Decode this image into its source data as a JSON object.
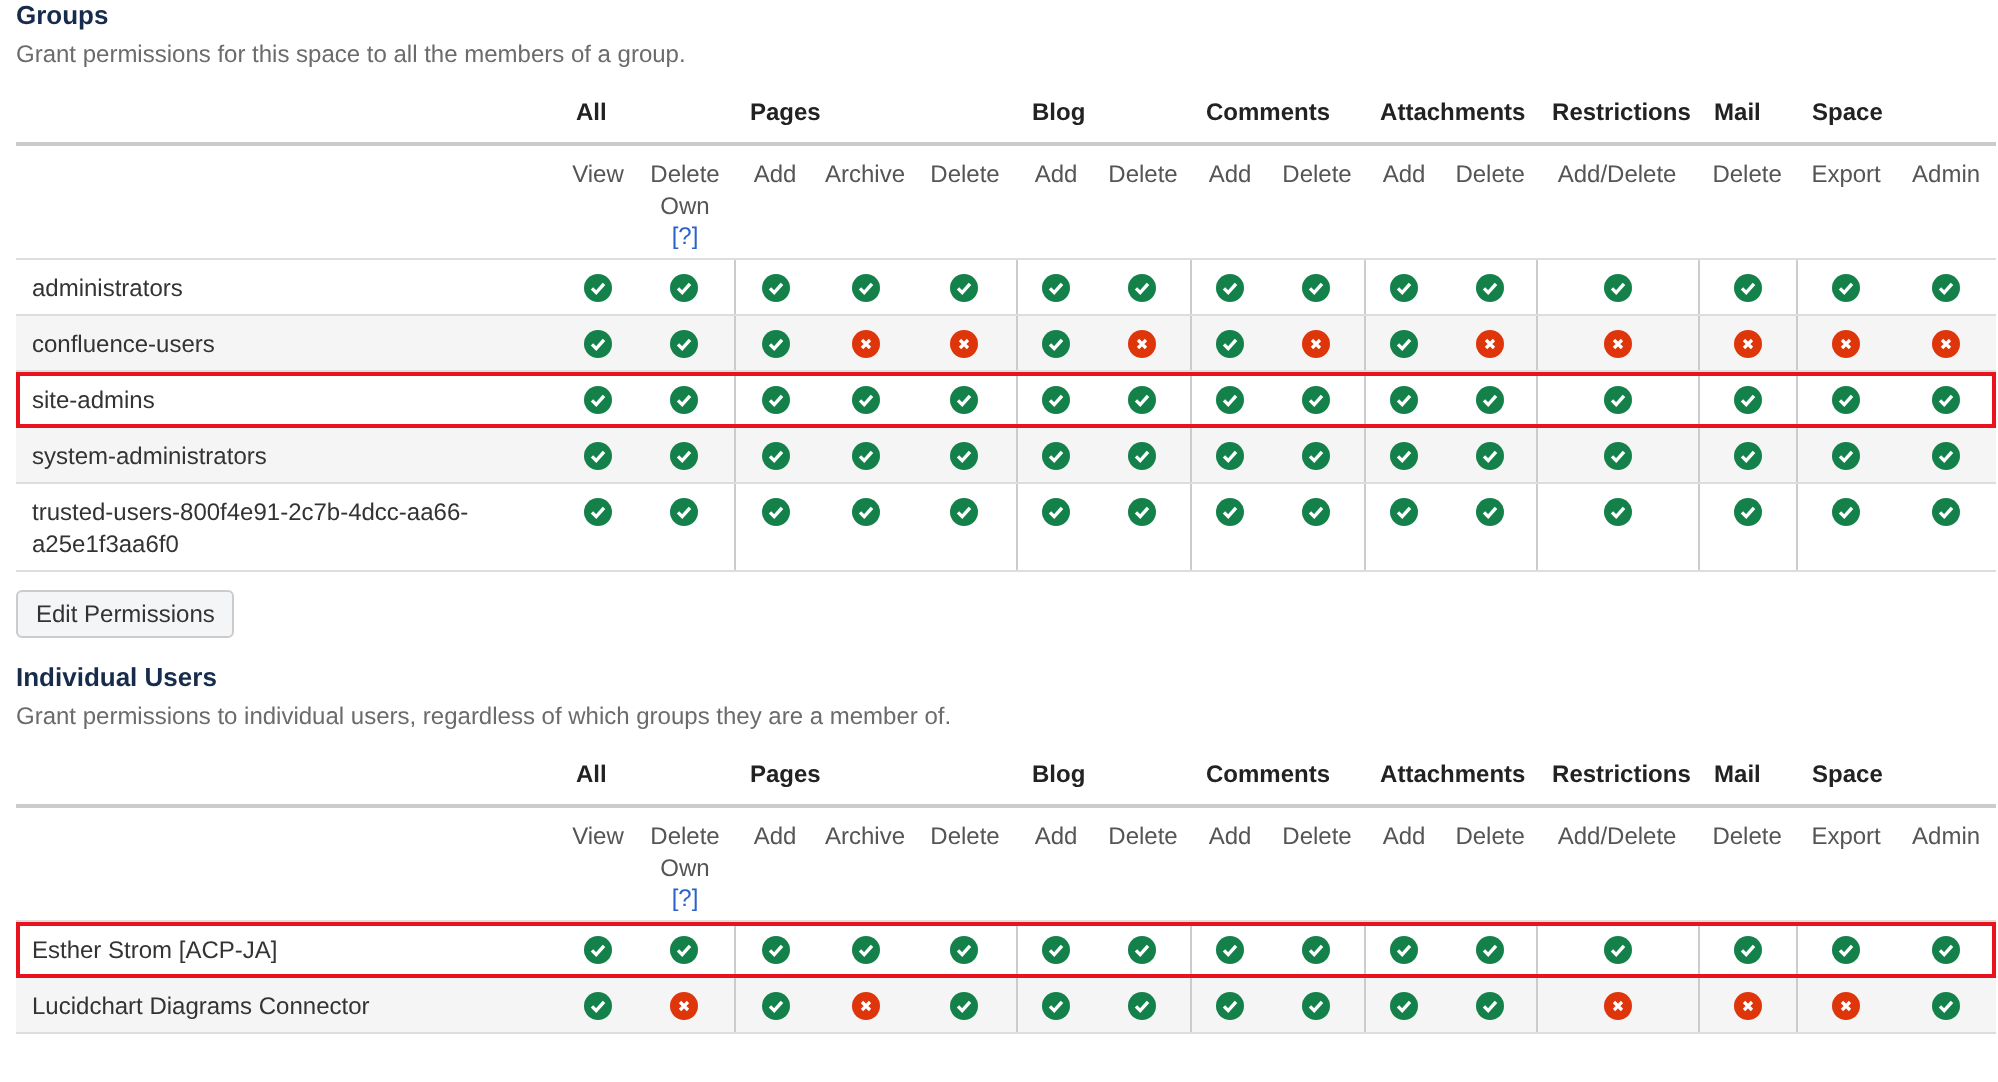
{
  "sections": [
    {
      "title": "Groups",
      "description": "Grant permissions for this space to all the members of a group.",
      "column_groups": [
        {
          "label": "All",
          "columns": [
            {
              "label": "View"
            },
            {
              "label": "Delete Own",
              "help": "[?]"
            }
          ]
        },
        {
          "label": "Pages",
          "columns": [
            {
              "label": "Add"
            },
            {
              "label": "Archive"
            },
            {
              "label": "Delete"
            }
          ]
        },
        {
          "label": "Blog",
          "columns": [
            {
              "label": "Add"
            },
            {
              "label": "Delete"
            }
          ]
        },
        {
          "label": "Comments",
          "columns": [
            {
              "label": "Add"
            },
            {
              "label": "Delete"
            }
          ]
        },
        {
          "label": "Attachments",
          "columns": [
            {
              "label": "Add"
            },
            {
              "label": "Delete"
            }
          ]
        },
        {
          "label": "Restrictions",
          "columns": [
            {
              "label": "Add/Delete"
            }
          ]
        },
        {
          "label": "Mail",
          "columns": [
            {
              "label": "Delete"
            }
          ]
        },
        {
          "label": "Space",
          "columns": [
            {
              "label": "Export"
            },
            {
              "label": "Admin"
            }
          ]
        }
      ],
      "rows": [
        {
          "name": "administrators",
          "highlighted": false,
          "permissions": [
            true,
            true,
            true,
            true,
            true,
            true,
            true,
            true,
            true,
            true,
            true,
            true,
            true,
            true,
            true
          ]
        },
        {
          "name": "confluence-users",
          "highlighted": false,
          "permissions": [
            true,
            true,
            true,
            false,
            false,
            true,
            false,
            true,
            false,
            true,
            false,
            false,
            false,
            false,
            false
          ]
        },
        {
          "name": "site-admins",
          "highlighted": true,
          "permissions": [
            true,
            true,
            true,
            true,
            true,
            true,
            true,
            true,
            true,
            true,
            true,
            true,
            true,
            true,
            true
          ]
        },
        {
          "name": "system-administrators",
          "highlighted": false,
          "permissions": [
            true,
            true,
            true,
            true,
            true,
            true,
            true,
            true,
            true,
            true,
            true,
            true,
            true,
            true,
            true
          ]
        },
        {
          "name": "trusted-users-800f4e91-2c7b-4dcc-aa66-a25e1f3aa6f0",
          "highlighted": false,
          "permissions": [
            true,
            true,
            true,
            true,
            true,
            true,
            true,
            true,
            true,
            true,
            true,
            true,
            true,
            true,
            true
          ]
        }
      ],
      "button": "Edit Permissions"
    },
    {
      "title": "Individual Users",
      "description": "Grant permissions to individual users, regardless of which groups they are a member of.",
      "column_groups": [
        {
          "label": "All",
          "columns": [
            {
              "label": "View"
            },
            {
              "label": "Delete Own",
              "help": "[?]"
            }
          ]
        },
        {
          "label": "Pages",
          "columns": [
            {
              "label": "Add"
            },
            {
              "label": "Archive"
            },
            {
              "label": "Delete"
            }
          ]
        },
        {
          "label": "Blog",
          "columns": [
            {
              "label": "Add"
            },
            {
              "label": "Delete"
            }
          ]
        },
        {
          "label": "Comments",
          "columns": [
            {
              "label": "Add"
            },
            {
              "label": "Delete"
            }
          ]
        },
        {
          "label": "Attachments",
          "columns": [
            {
              "label": "Add"
            },
            {
              "label": "Delete"
            }
          ]
        },
        {
          "label": "Restrictions",
          "columns": [
            {
              "label": "Add/Delete"
            }
          ]
        },
        {
          "label": "Mail",
          "columns": [
            {
              "label": "Delete"
            }
          ]
        },
        {
          "label": "Space",
          "columns": [
            {
              "label": "Export"
            },
            {
              "label": "Admin"
            }
          ]
        }
      ],
      "rows": [
        {
          "name": "Esther Strom [ACP-JA]",
          "highlighted": true,
          "permissions": [
            true,
            true,
            true,
            true,
            true,
            true,
            true,
            true,
            true,
            true,
            true,
            true,
            true,
            true,
            true
          ]
        },
        {
          "name": "Lucidchart Diagrams Connector",
          "highlighted": false,
          "permissions": [
            true,
            false,
            true,
            false,
            true,
            true,
            true,
            true,
            true,
            true,
            true,
            false,
            false,
            false,
            true
          ]
        }
      ]
    }
  ]
}
